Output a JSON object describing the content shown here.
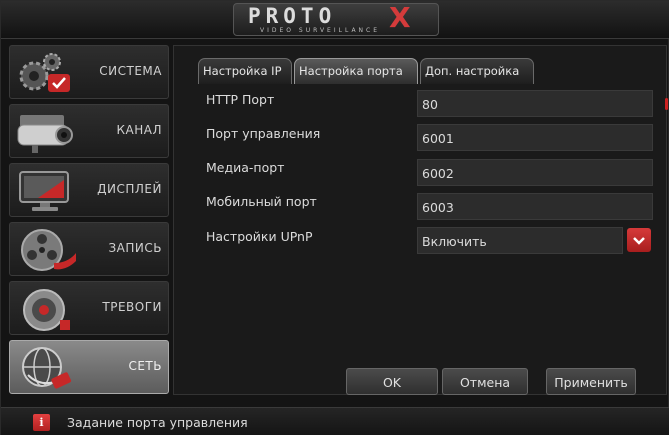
{
  "header": {
    "logo_main": "PROTO",
    "logo_x": "X",
    "logo_sub": "VIDEO SURVEILLANCE"
  },
  "sidebar": {
    "items": [
      {
        "label": "СИСТЕМА",
        "icon": "gears-icon",
        "active": false
      },
      {
        "label": "КАНАЛ",
        "icon": "camera-icon",
        "active": false
      },
      {
        "label": "ДИСПЛЕЙ",
        "icon": "monitor-icon",
        "active": false
      },
      {
        "label": "ЗАПИСЬ",
        "icon": "film-reel-icon",
        "active": false
      },
      {
        "label": "ТРЕВОГИ",
        "icon": "alarm-bell-icon",
        "active": false
      },
      {
        "label": "СЕТЬ",
        "icon": "globe-network-icon",
        "active": true
      }
    ]
  },
  "tabs": [
    {
      "label": "Настройка IP",
      "active": false
    },
    {
      "label": "Настройка порта",
      "active": true
    },
    {
      "label": "Доп. настройка",
      "active": false
    }
  ],
  "form": {
    "http_port": {
      "label": "HTTP Порт",
      "value": "80"
    },
    "control_port": {
      "label": "Порт управления",
      "value": "6001"
    },
    "media_port": {
      "label": "Медиа-порт",
      "value": "6002"
    },
    "mobile_port": {
      "label": "Мобильный порт",
      "value": "6003"
    },
    "upnp": {
      "label": "Настройки UPnP",
      "value": "Включить"
    }
  },
  "buttons": {
    "ok": "OK",
    "cancel": "Отмена",
    "apply": "Применить"
  },
  "status": {
    "icon": "i",
    "text": "Задание порта управления"
  },
  "colors": {
    "accent_red": "#c62828",
    "background": "#141414",
    "field": "#2c2c2c"
  }
}
